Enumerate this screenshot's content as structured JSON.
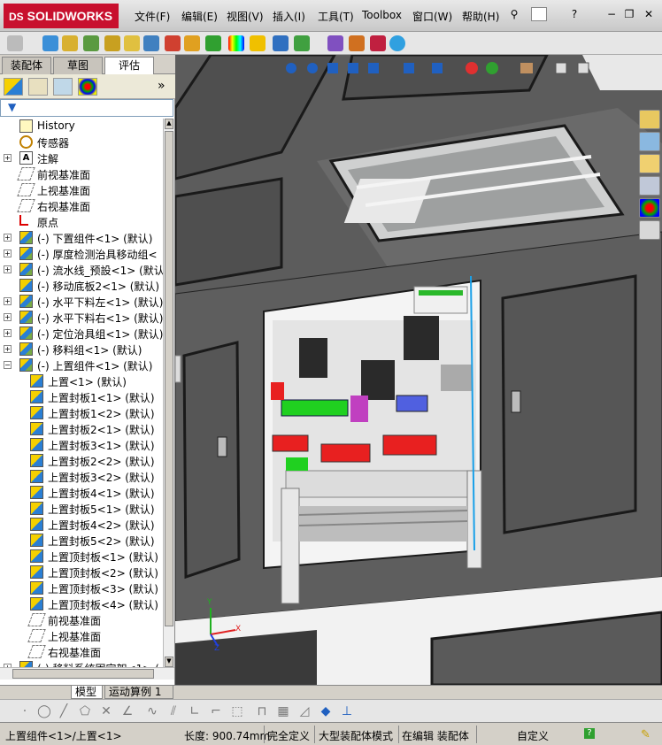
{
  "app": {
    "logo": "SOLIDWORKS",
    "logo_prefix": "DS"
  },
  "menu": [
    "文件(F)",
    "编辑(E)",
    "视图(V)",
    "插入(I)",
    "工具(T)",
    "Toolbox",
    "窗口(W)",
    "帮助(H)"
  ],
  "window_controls": {
    "help": "?",
    "minimize": "−",
    "restore": "❐",
    "close": "✕"
  },
  "panel_tabs": [
    "装配体",
    "草图",
    "评估"
  ],
  "panel_active_tab": "评估",
  "panel_more": "»",
  "tree": [
    {
      "label": "History",
      "icon": "history-icon",
      "indent": 1,
      "expander": ""
    },
    {
      "label": "传感器",
      "icon": "sensor-icon",
      "indent": 1,
      "expander": ""
    },
    {
      "label": "注解",
      "icon": "annotation-icon",
      "indent": 1,
      "expander": "+"
    },
    {
      "label": "前视基准面",
      "icon": "plane-icon",
      "indent": 1,
      "expander": ""
    },
    {
      "label": "上视基准面",
      "icon": "plane-icon",
      "indent": 1,
      "expander": ""
    },
    {
      "label": "右视基准面",
      "icon": "plane-icon",
      "indent": 1,
      "expander": ""
    },
    {
      "label": "原点",
      "icon": "origin-icon",
      "indent": 1,
      "expander": ""
    },
    {
      "label": "(-) 下置组件<1> (默认)",
      "icon": "assembly-icon",
      "indent": 1,
      "expander": "+"
    },
    {
      "label": "(-) 厚度检测治具移动组<",
      "icon": "assembly-icon",
      "indent": 1,
      "expander": "+"
    },
    {
      "label": "(-) 流水线_预設<1> (默认",
      "icon": "assembly-icon",
      "indent": 1,
      "expander": "+"
    },
    {
      "label": "(-) 移动底板2<1> (默认)",
      "icon": "part-icon",
      "indent": 1,
      "expander": ""
    },
    {
      "label": "(-) 水平下料左<1> (默认)",
      "icon": "assembly-icon",
      "indent": 1,
      "expander": "+"
    },
    {
      "label": "(-) 水平下料右<1> (默认)",
      "icon": "assembly-icon",
      "indent": 1,
      "expander": "+"
    },
    {
      "label": "(-) 定位治具组<1> (默认)",
      "icon": "assembly-icon",
      "indent": 1,
      "expander": "+"
    },
    {
      "label": "(-) 移料组<1> (默认)",
      "icon": "assembly-icon",
      "indent": 1,
      "expander": "+"
    },
    {
      "label": "(-) 上置组件<1> (默认)",
      "icon": "assembly-icon",
      "indent": 1,
      "expander": "−"
    },
    {
      "label": "上置<1> (默认)",
      "icon": "part-icon",
      "indent": 2,
      "expander": ""
    },
    {
      "label": "上置封板1<1> (默认)",
      "icon": "part-icon",
      "indent": 2,
      "expander": ""
    },
    {
      "label": "上置封板1<2> (默认)",
      "icon": "part-icon",
      "indent": 2,
      "expander": ""
    },
    {
      "label": "上置封板2<1> (默认)",
      "icon": "part-icon",
      "indent": 2,
      "expander": ""
    },
    {
      "label": "上置封板3<1> (默认)",
      "icon": "part-icon",
      "indent": 2,
      "expander": ""
    },
    {
      "label": "上置封板2<2> (默认)",
      "icon": "part-icon",
      "indent": 2,
      "expander": ""
    },
    {
      "label": "上置封板3<2> (默认)",
      "icon": "part-icon",
      "indent": 2,
      "expander": ""
    },
    {
      "label": "上置封板4<1> (默认)",
      "icon": "part-icon",
      "indent": 2,
      "expander": ""
    },
    {
      "label": "上置封板5<1> (默认)",
      "icon": "part-icon",
      "indent": 2,
      "expander": ""
    },
    {
      "label": "上置封板4<2> (默认)",
      "icon": "part-icon",
      "indent": 2,
      "expander": ""
    },
    {
      "label": "上置封板5<2> (默认)",
      "icon": "part-icon",
      "indent": 2,
      "expander": ""
    },
    {
      "label": "上置顶封板<1> (默认)",
      "icon": "part-icon",
      "indent": 2,
      "expander": ""
    },
    {
      "label": "上置顶封板<2> (默认)",
      "icon": "part-icon",
      "indent": 2,
      "expander": ""
    },
    {
      "label": "上置顶封板<3> (默认)",
      "icon": "part-icon",
      "indent": 2,
      "expander": ""
    },
    {
      "label": "上置顶封板<4> (默认)",
      "icon": "part-icon",
      "indent": 2,
      "expander": ""
    },
    {
      "label": "前视基准面",
      "icon": "plane-icon",
      "indent": 2,
      "expander": ""
    },
    {
      "label": "上视基准面",
      "icon": "plane-icon",
      "indent": 2,
      "expander": ""
    },
    {
      "label": "右视基准面",
      "icon": "plane-icon",
      "indent": 2,
      "expander": ""
    },
    {
      "label": "(-) 移料系统固定架<1> (",
      "icon": "assembly-icon",
      "indent": 1,
      "expander": "+"
    }
  ],
  "bottom_tabs": [
    "模型",
    "运动算例 1"
  ],
  "bottom_active_tab": "模型",
  "status": {
    "selection": "上置组件<1>/上置<1>",
    "length": "长度: 900.74mm",
    "state": "完全定义",
    "mode": "大型装配体模式",
    "editing": "在编辑 装配体",
    "units": "自定义"
  },
  "triad": {
    "x": "X",
    "y": "Y",
    "z": "Z"
  }
}
